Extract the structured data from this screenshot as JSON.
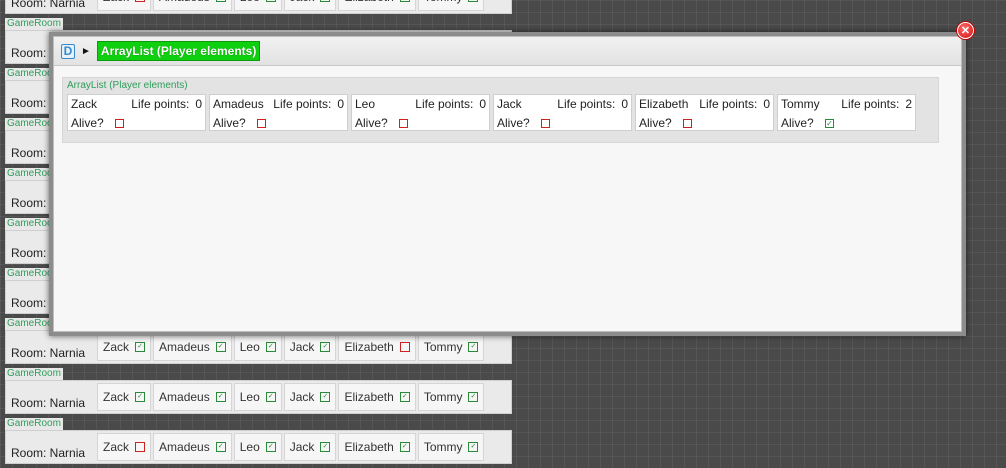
{
  "background_rooms": {
    "tag": "GameRoom",
    "room_label": "Room: Narnia",
    "rows": [
      {
        "players": [
          {
            "name": "Zack",
            "alive": false
          },
          {
            "name": "Amadeus",
            "alive": true
          },
          {
            "name": "Leo",
            "alive": true
          },
          {
            "name": "Jack",
            "alive": true
          },
          {
            "name": "Elizabeth",
            "alive": true
          },
          {
            "name": "Tommy",
            "alive": true
          }
        ]
      },
      {
        "players": []
      },
      {
        "players": []
      },
      {
        "players": []
      },
      {
        "players": []
      },
      {
        "players": []
      },
      {
        "players": []
      },
      {
        "players": [
          {
            "name": "Zack",
            "alive": true
          },
          {
            "name": "Amadeus",
            "alive": true
          },
          {
            "name": "Leo",
            "alive": true
          },
          {
            "name": "Jack",
            "alive": true
          },
          {
            "name": "Elizabeth",
            "alive": false
          },
          {
            "name": "Tommy",
            "alive": true
          }
        ]
      },
      {
        "players": [
          {
            "name": "Zack",
            "alive": true
          },
          {
            "name": "Amadeus",
            "alive": true
          },
          {
            "name": "Leo",
            "alive": true
          },
          {
            "name": "Jack",
            "alive": true
          },
          {
            "name": "Elizabeth",
            "alive": true
          },
          {
            "name": "Tommy",
            "alive": true
          }
        ]
      },
      {
        "players": [
          {
            "name": "Zack",
            "alive": false
          },
          {
            "name": "Amadeus",
            "alive": true
          },
          {
            "name": "Leo",
            "alive": true
          },
          {
            "name": "Jack",
            "alive": true
          },
          {
            "name": "Elizabeth",
            "alive": true
          },
          {
            "name": "Tommy",
            "alive": true
          }
        ]
      }
    ]
  },
  "modal": {
    "type_icon": "D",
    "title": "ArrayList (Player elements)",
    "close_icon": "close-icon",
    "array_label": "ArrayList (Player elements)",
    "life_label": "Life points:",
    "alive_label": "Alive?",
    "players": [
      {
        "name": "Zack",
        "life_points": "0",
        "alive": false
      },
      {
        "name": "Amadeus",
        "life_points": "0",
        "alive": false
      },
      {
        "name": "Leo",
        "life_points": "0",
        "alive": false
      },
      {
        "name": "Jack",
        "life_points": "0",
        "alive": false
      },
      {
        "name": "Elizabeth",
        "life_points": "0",
        "alive": false
      },
      {
        "name": "Tommy",
        "life_points": "2",
        "alive": true
      }
    ]
  },
  "colors": {
    "accent_green": "#0fd00f",
    "dead_red": "#cc2222",
    "alive_green": "#2a8a3a"
  }
}
